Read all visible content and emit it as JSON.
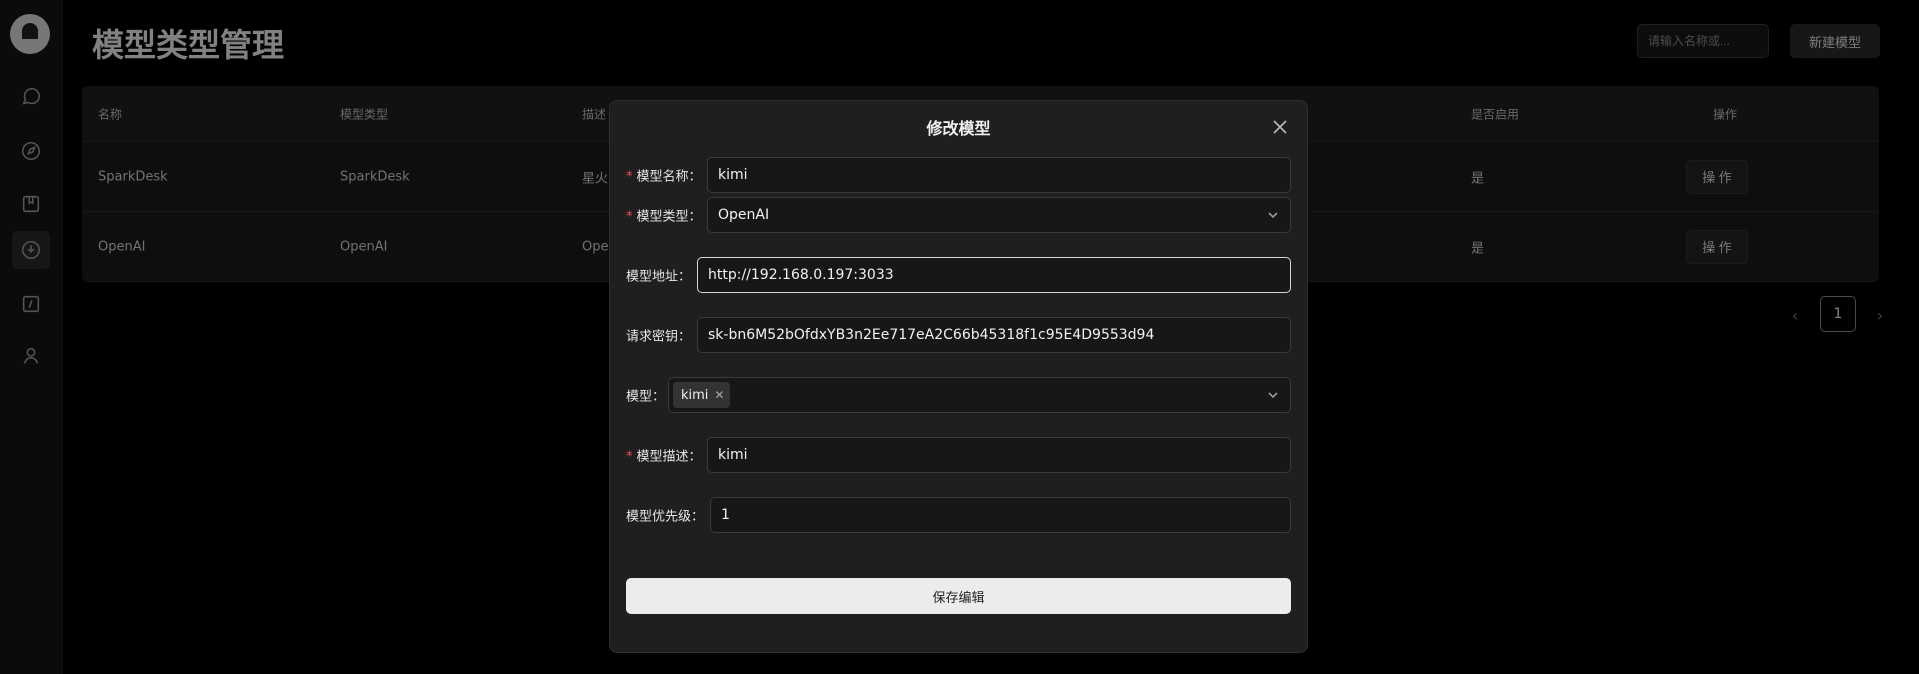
{
  "page": {
    "title": "模型类型管理",
    "search_placeholder": "请输入名称或...",
    "new_button": "新建模型"
  },
  "sidebar": {
    "icons": [
      "logo",
      "chat-icon",
      "compass-icon",
      "folder-icon",
      "model-icon",
      "edit-icon",
      "user-icon"
    ],
    "active": "model-icon"
  },
  "table": {
    "headers": [
      "名称",
      "模型类型",
      "描述",
      "是否启用",
      "操作"
    ],
    "rows": [
      {
        "name": "SparkDesk",
        "type": "SparkDesk",
        "desc": "星火",
        "enabled": "是",
        "action": "操 作"
      },
      {
        "name": "OpenAI",
        "type": "OpenAI",
        "desc": "Ope",
        "enabled": "是",
        "action": "操 作"
      }
    ]
  },
  "pagination": {
    "prev": "‹",
    "current": "1",
    "next": "›"
  },
  "modal": {
    "title": "修改模型",
    "fields": {
      "name": {
        "label": "模型名称：",
        "value": "kimi",
        "required": true
      },
      "type": {
        "label": "模型类型：",
        "value": "OpenAI",
        "required": true
      },
      "address": {
        "label": "模型地址：",
        "value": "http://192.168.0.197:3033"
      },
      "key": {
        "label": "请求密钥：",
        "value": "sk-bn6M52bOfdxYB3n2Ee717eA2C66b45318f1c95E4D9553d94"
      },
      "model": {
        "label": "模型：",
        "tag": "kimi"
      },
      "description": {
        "label": "模型描述：",
        "value": "kimi",
        "required": true
      },
      "priority": {
        "label": "模型优先级：",
        "value": "1"
      }
    },
    "submit": "保存编辑"
  },
  "colors": {
    "background": "#000000",
    "modal": "#1f1f1f",
    "required": "#ff4d4f",
    "submit": "#ececec"
  }
}
